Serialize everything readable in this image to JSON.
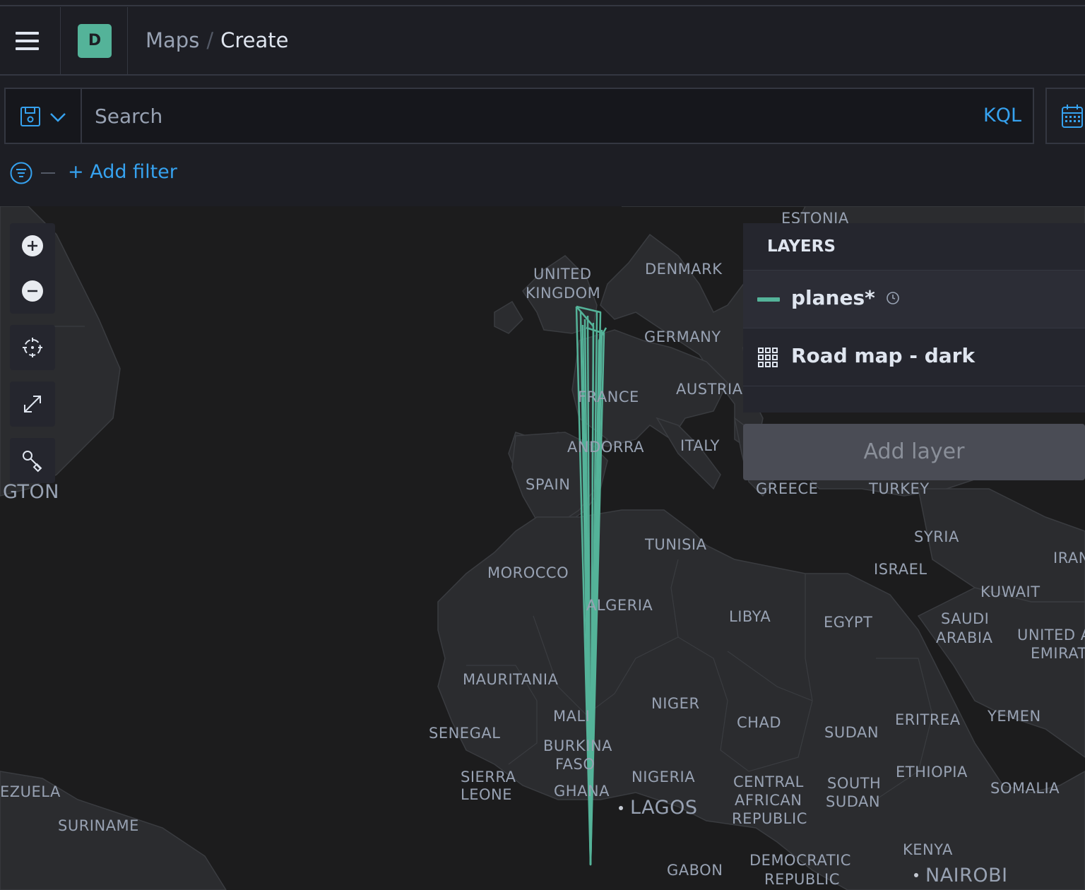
{
  "header": {
    "space_initial": "D",
    "breadcrumbs": [
      "Maps",
      "Create"
    ],
    "breadcrumb_separator": "/"
  },
  "query": {
    "placeholder": "Search",
    "language": "KQL"
  },
  "filters": {
    "add_label": "+ Add filter"
  },
  "layers_panel": {
    "title": "LAYERS",
    "layers": [
      {
        "name": "planes*",
        "type": "line",
        "color": "#54b399",
        "has_time_filter": true,
        "selected": true
      },
      {
        "name": "Road map - dark",
        "type": "tiles",
        "color": "#dfe5ef",
        "has_time_filter": false,
        "selected": false
      }
    ],
    "add_layer_label": "Add layer"
  },
  "map_controls": [
    "zoom-in-icon",
    "zoom-out-icon",
    "set-view-icon",
    "fullscreen-icon",
    "tools-icon"
  ],
  "map_labels": {
    "estonia": "ESTONIA",
    "uk1": "UNITED",
    "uk2": "KINGDOM",
    "denmark": "DENMARK",
    "germany": "GERMANY",
    "france": "FRANCE",
    "austria": "AUSTRIA",
    "andorra": "ANDORRA",
    "italy": "ITALY",
    "spain": "SPAIN",
    "greece": "GREECE",
    "turkey": "TURKEY",
    "washington": "GTON",
    "tunisia": "TUNISIA",
    "syria": "SYRIA",
    "iran": "IRAN",
    "morocco": "MOROCCO",
    "israel": "ISRAEL",
    "kuwait": "KUWAIT",
    "algeria": "ALGERIA",
    "libya": "LIBYA",
    "egypt": "EGYPT",
    "saudi1": "SAUDI",
    "saudi2": "ARABIA",
    "uae1": "UNITED A",
    "uae2": "EMIRAT",
    "mauritania": "MAURITANIA",
    "niger": "NIGER",
    "chad": "CHAD",
    "eritrea": "ERITREA",
    "yemen": "YEMEN",
    "mali": "MALI",
    "senegal": "SENEGAL",
    "sudan": "SUDAN",
    "burkina1": "BURKINA",
    "burkina2": "FASO",
    "sierra1": "SIERRA",
    "sierra2": "LEONE",
    "nigeria": "NIGERIA",
    "car1": "CENTRAL",
    "car2": "AFRICAN",
    "car3": "REPUBLIC",
    "ssudan1": "SOUTH",
    "ssudan2": "SUDAN",
    "ethiopia": "ETHIOPIA",
    "somalia": "SOMALIA",
    "venezuela": "EZUELA",
    "ghana": "GHANA",
    "lagos": "LAGOS",
    "suriname": "SURINAME",
    "kenya": "KENYA",
    "gabon": "GABON",
    "drc1": "DEMOCRATIC",
    "drc2": "REPUBLIC",
    "nairobi": "NAIROBI"
  }
}
